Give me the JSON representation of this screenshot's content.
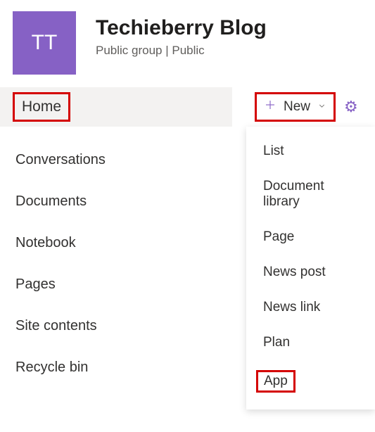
{
  "site": {
    "logo_text": "TT",
    "title": "Techieberry Blog",
    "subtitle": "Public group | Public"
  },
  "sidebar": {
    "home_label": "Home",
    "items": [
      {
        "label": "Conversations"
      },
      {
        "label": "Documents"
      },
      {
        "label": "Notebook"
      },
      {
        "label": "Pages"
      },
      {
        "label": "Site contents"
      },
      {
        "label": "Recycle bin"
      }
    ]
  },
  "toolbar": {
    "new_label": "New"
  },
  "new_menu": {
    "items": [
      {
        "label": "List"
      },
      {
        "label": "Document library"
      },
      {
        "label": "Page"
      },
      {
        "label": "News post"
      },
      {
        "label": "News link"
      },
      {
        "label": "Plan"
      },
      {
        "label": "App"
      }
    ]
  }
}
